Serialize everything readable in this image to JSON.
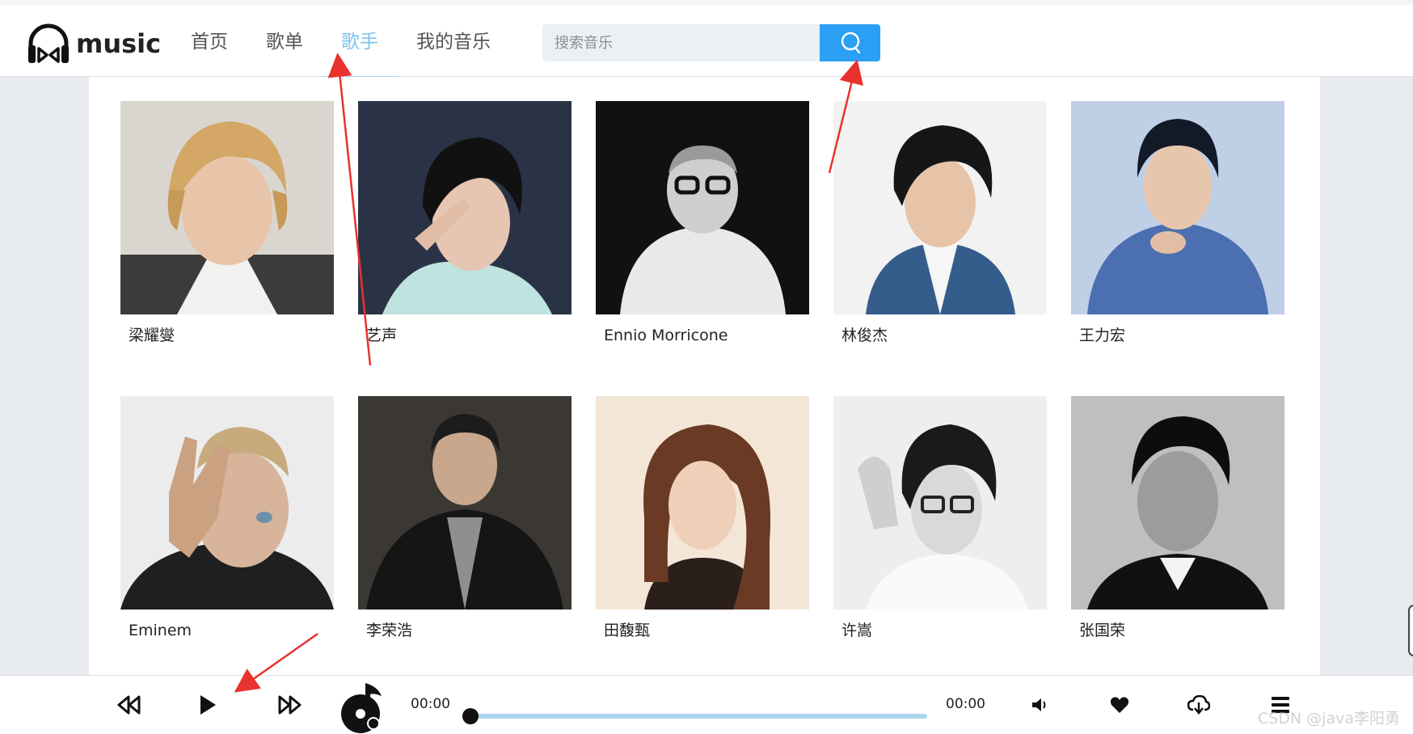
{
  "app": {
    "logo_text": "music"
  },
  "nav": {
    "items": [
      {
        "label": "首页",
        "active": false
      },
      {
        "label": "歌单",
        "active": false
      },
      {
        "label": "歌手",
        "active": true
      },
      {
        "label": "我的音乐",
        "active": false
      }
    ]
  },
  "search": {
    "placeholder": "搜索音乐",
    "icon": "search-icon"
  },
  "singers": [
    {
      "name": "梁耀燮"
    },
    {
      "name": "艺声"
    },
    {
      "name": "Ennio Morricone"
    },
    {
      "name": "林俊杰"
    },
    {
      "name": "王力宏"
    },
    {
      "name": "Eminem"
    },
    {
      "name": "李荣浩"
    },
    {
      "name": "田馥甄"
    },
    {
      "name": "许嵩"
    },
    {
      "name": "张国荣"
    }
  ],
  "player": {
    "current_time": "00:00",
    "total_time": "00:00",
    "progress": 0,
    "buttons": [
      "prev-icon",
      "play-icon",
      "next-icon",
      "volume-icon",
      "heart-icon",
      "download-icon",
      "playlist-icon"
    ]
  },
  "watermark": "CSDN @java李阳勇",
  "colors": {
    "accent": "#2a9ff3",
    "nav_active": "#7cc3ec",
    "progress": "#acd6f0"
  }
}
